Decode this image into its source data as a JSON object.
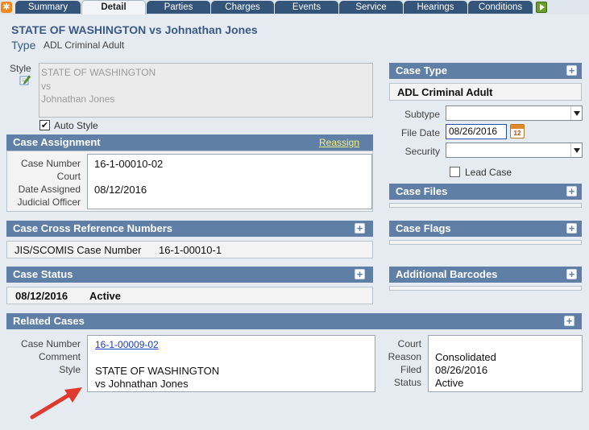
{
  "tabs": [
    {
      "label": "Summary"
    },
    {
      "label": "Detail"
    },
    {
      "label": "Parties"
    },
    {
      "label": "Charges"
    },
    {
      "label": "Events"
    },
    {
      "label": "Service"
    },
    {
      "label": "Hearings"
    },
    {
      "label": "Conditions"
    }
  ],
  "header": {
    "title": "STATE OF WASHINGTON vs Johnathan Jones",
    "type_label": "Type",
    "type_value": "ADL Criminal Adult"
  },
  "style": {
    "label": "Style",
    "line1": "STATE OF WASHINGTON",
    "line2": "vs",
    "line3": "Johnathan Jones",
    "auto_style_label": "Auto Style",
    "auto_style_checked": true
  },
  "case_assignment": {
    "title": "Case Assignment",
    "reassign": "Reassign",
    "labels": {
      "case_number": "Case Number",
      "court": "Court",
      "date_assigned": "Date Assigned",
      "judicial_officer": "Judicial Officer"
    },
    "case_number": "16-1-00010-02",
    "date_assigned": "08/12/2016"
  },
  "cross_ref": {
    "title": "Case Cross Reference Numbers",
    "label": "JIS/SCOMIS Case Number",
    "value": "16-1-00010-1"
  },
  "case_status": {
    "title": "Case Status",
    "date": "08/12/2016",
    "status": "Active"
  },
  "related_cases": {
    "title": "Related Cases",
    "labels": {
      "case_number": "Case Number",
      "comment": "Comment",
      "style": "Style",
      "court": "Court",
      "reason": "Reason",
      "filed": "Filed",
      "status": "Status"
    },
    "case_number": "16-1-00009-02",
    "style_line1": "STATE OF WASHINGTON",
    "style_line2": "vs Johnathan Jones",
    "reason": "Consolidated",
    "filed": "08/26/2016",
    "status": "Active"
  },
  "case_type": {
    "title": "Case Type",
    "value": "ADL Criminal Adult",
    "subtype_label": "Subtype",
    "file_date_label": "File Date",
    "file_date": "08/26/2016",
    "security_label": "Security",
    "lead_case_label": "Lead Case"
  },
  "case_files": {
    "title": "Case Files"
  },
  "case_flags": {
    "title": "Case Flags"
  },
  "additional_barcodes": {
    "title": "Additional Barcodes"
  },
  "icons": {
    "plus": "+",
    "calendar_day": "12"
  },
  "colors": {
    "tab_bg": "#34547a",
    "section_header": "#5f7fa7",
    "title_text": "#3a5a85",
    "reassign_link": "#f7f27a",
    "arrow": "#e03a2f"
  }
}
